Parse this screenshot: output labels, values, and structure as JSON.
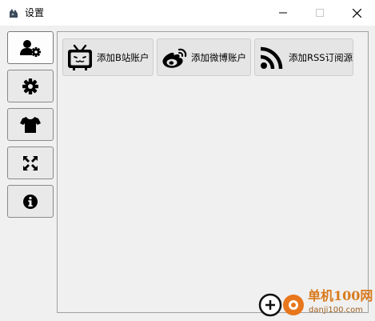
{
  "window": {
    "title": "设置",
    "controls": [
      "minimize-icon",
      "maximize-icon",
      "close-icon"
    ]
  },
  "sidebar": {
    "items": [
      {
        "icon": "user-cog-icon",
        "active": true
      },
      {
        "icon": "gear-icon",
        "active": false
      },
      {
        "icon": "tshirt-icon",
        "active": false
      },
      {
        "icon": "expand-icon",
        "active": false
      },
      {
        "icon": "info-icon",
        "active": false
      }
    ]
  },
  "main": {
    "buttons": [
      {
        "label": "添加B站账户",
        "icon": "bilibili-tv-icon"
      },
      {
        "label": "添加微博账户",
        "icon": "weibo-icon"
      },
      {
        "label": "添加RSS订阅源",
        "icon": "rss-icon"
      }
    ]
  },
  "watermark": {
    "title": "单机100网",
    "url": "danji100.com"
  },
  "colors": {
    "accent_orange": "#e8761c",
    "panel_border": "#a0a0a0"
  }
}
